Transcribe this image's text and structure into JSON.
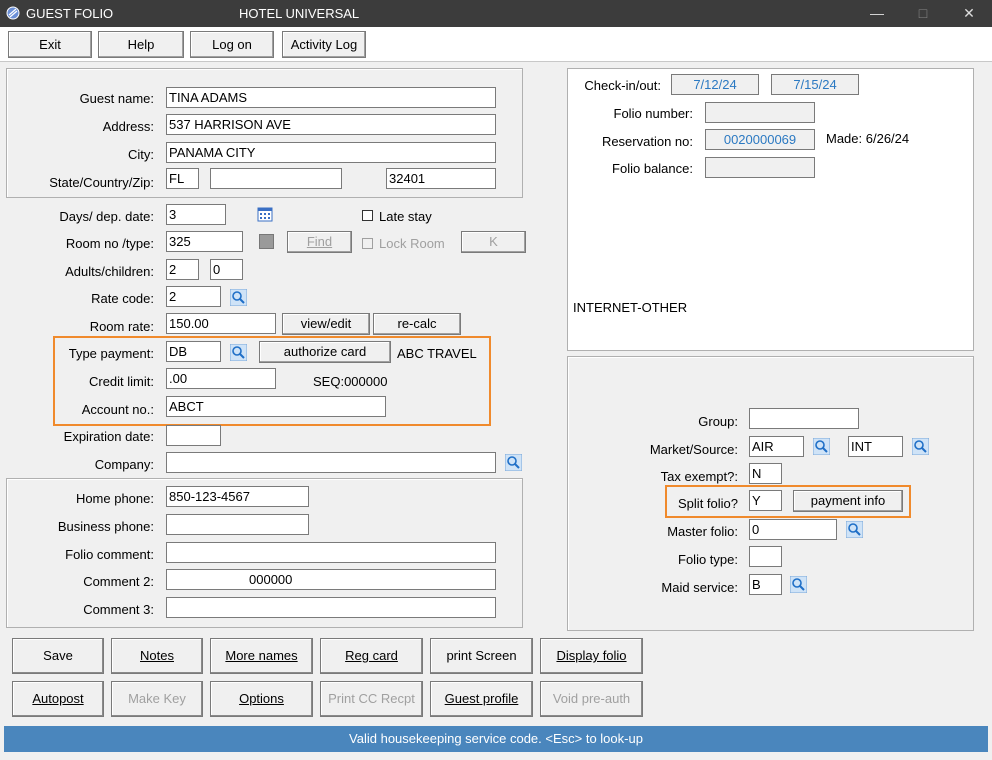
{
  "window": {
    "title": "GUEST FOLIO",
    "hotel": "HOTEL UNIVERSAL"
  },
  "toolbar": {
    "exit": "Exit",
    "help": "Help",
    "logon": "Log on",
    "activity_log": "Activity Log"
  },
  "guest": {
    "name_label": "Guest name:",
    "name": "TINA ADAMS",
    "address_label": "Address:",
    "address": "537 HARRISON AVE",
    "city_label": "City:",
    "city": "PANAMA CITY",
    "szip_label": "State/Country/Zip:",
    "state": "FL",
    "country": "",
    "zip": "32401"
  },
  "stay": {
    "days_label": "Days/ dep. date:",
    "days": "3",
    "late_stay": "Late stay",
    "room_label": "Room no /type:",
    "room": "325",
    "find": "Find",
    "lock_room": "Lock Room",
    "key": "K",
    "adults_label": "Adults/children:",
    "adults": "2",
    "children": "0",
    "rate_code_label": "Rate code:",
    "rate_code": "2",
    "room_rate_label": "Room rate:",
    "room_rate": "150.00",
    "view_edit": "view/edit",
    "recalc": "re-calc"
  },
  "payment": {
    "type_label": "Type payment:",
    "type": "DB",
    "authorize": "authorize card",
    "company_name": "ABC TRAVEL",
    "credit_label": "Credit limit:",
    "credit": ".00",
    "seq": "SEQ:000000",
    "account_label": "Account no.:",
    "account": "ABCT",
    "exp_label": "Expiration date:",
    "exp": "",
    "company_label": "Company:",
    "company": ""
  },
  "contact": {
    "home_label": "Home phone:",
    "home": "850-123-4567",
    "business_label": "Business phone:",
    "business": "",
    "folio_comment_label": "Folio comment:",
    "folio_comment": "",
    "comment2_label": "Comment 2:",
    "comment2": "000000",
    "comment3_label": "Comment 3:",
    "comment3": ""
  },
  "reservation": {
    "checkin_label": "Check-in/out:",
    "checkin": "7/12/24",
    "checkout": "7/15/24",
    "folio_no_label": "Folio number:",
    "folio_no": "",
    "res_no_label": "Reservation no:",
    "res_no": "0020000069",
    "made": "Made:  6/26/24",
    "balance_label": "Folio balance:",
    "balance": "",
    "source_text": "INTERNET-OTHER"
  },
  "extra": {
    "group_label": "Group:",
    "group": "",
    "market_label": "Market/Source:",
    "market": "AIR",
    "source": "INT",
    "tax_label": "Tax exempt?:",
    "tax": "N",
    "split_label": "Split folio?",
    "split": "Y",
    "payment_info": "payment info",
    "master_label": "Master folio:",
    "master": "0",
    "ftype_label": "Folio type:",
    "ftype": "",
    "maid_label": "Maid service:",
    "maid": "B"
  },
  "actions": {
    "save": "Save",
    "notes": "Notes",
    "more_names": "More names",
    "reg_card": "Reg card",
    "print_screen": "print Screen",
    "display_folio": "Display folio",
    "autopost": "Autopost",
    "make_key": "Make Key",
    "options": "Options",
    "print_cc": "Print CC Recpt",
    "guest_profile": "Guest profile",
    "void_preauth": "Void pre-auth"
  },
  "status": "Valid housekeeping service code. <Esc> to look-up",
  "colors": {
    "accent_highlight": "#f08a2c",
    "status_bar": "#4a86bd",
    "blue_value": "#2b79c2"
  }
}
